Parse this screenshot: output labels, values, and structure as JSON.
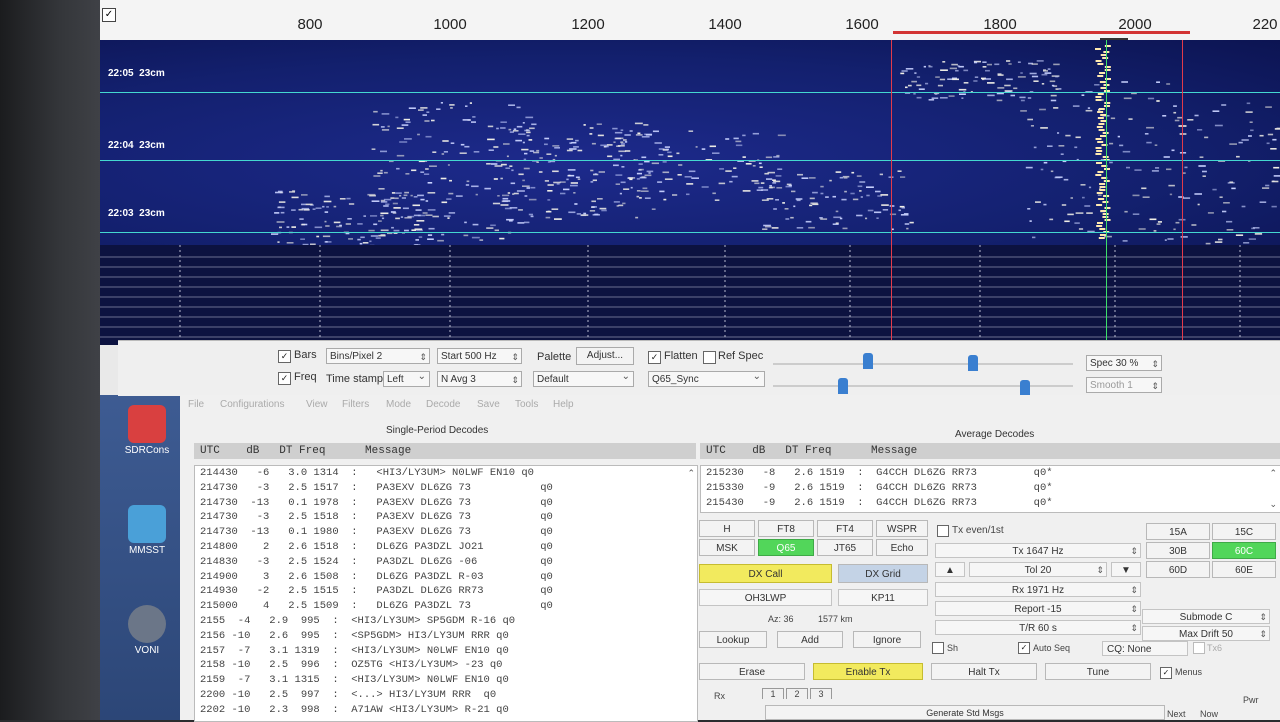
{
  "waterfall": {
    "freq_labels": [
      "800",
      "1000",
      "1200",
      "1400",
      "1600",
      "1800",
      "2000",
      "220"
    ],
    "time_labels": [
      {
        "time": "22:05",
        "band": "23cm"
      },
      {
        "time": "22:04",
        "band": "23cm"
      },
      {
        "time": "22:03",
        "band": "23cm"
      }
    ],
    "colors": {
      "rx_marker": "#d23434",
      "tx_marker": "#3dde6a",
      "trace": "#44d8d0"
    }
  },
  "controls": {
    "bars_label": "Bars",
    "freq_label": "Freq",
    "bins_per_pixel": "Bins/Pixel  2",
    "start": "Start 500 Hz",
    "time_stamp_label": "Time stamp",
    "time_stamp_value": "Left",
    "n_avg": "N Avg  3",
    "palette_label": "Palette",
    "adjust_label": "Adjust...",
    "palette_value": "Default",
    "flatten_label": "Flatten",
    "ref_spec_label": "Ref Spec",
    "mode_value": "Q65_Sync",
    "spec": "Spec  30 %",
    "smooth": "Smooth  1"
  },
  "main": {
    "menu": [
      "File",
      "Configurations",
      "View",
      "Filters",
      "Mode",
      "Decode",
      "Save",
      "Tools",
      "Help"
    ],
    "single_title": "Single-Period Decodes",
    "average_title": "Average Decodes",
    "header": "UTC    dB   DT Freq      Message",
    "single_decodes": [
      "214430   -6   3.0 1314  :   <HI3/LY3UM> N0LWF EN10 q0",
      "214730   -3   2.5 1517  :   PA3EXV DL6ZG 73           q0",
      "214730  -13   0.1 1978  :   PA3EXV DL6ZG 73           q0",
      "214730   -3   2.5 1518  :   PA3EXV DL6ZG 73           q0",
      "214730  -13   0.1 1980  :   PA3EXV DL6ZG 73           q0",
      "214800    2   2.6 1518  :   DL6ZG PA3DZL JO21         q0",
      "214830   -3   2.5 1524  :   PA3DZL DL6ZG -06          q0",
      "214900    3   2.6 1508  :   DL6ZG PA3DZL R-03         q0",
      "214930   -2   2.5 1515  :   PA3DZL DL6ZG RR73         q0",
      "215000    4   2.5 1509  :   DL6ZG PA3DZL 73           q0",
      "2155  -4   2.9  995  :  <HI3/LY3UM> SP5GDM R-16 q0",
      "2156 -10   2.6  995  :  <SP5GDM> HI3/LY3UM RRR q0",
      "2157  -7   3.1 1319  :  <HI3/LY3UM> N0LWF EN10 q0",
      "2158 -10   2.5  996  :  OZ5TG <HI3/LY3UM> -23 q0",
      "2159  -7   3.1 1315  :  <HI3/LY3UM> N0LWF EN10 q0",
      "2200 -10   2.5  997  :  <...> HI3/LY3UM RRR  q0",
      "2202 -10   2.3  998  :  A71AW <HI3/LY3UM> R-21 q0"
    ],
    "average_decodes": [
      "215230   -8   2.6 1519  :  G4CCH DL6ZG RR73         q0*",
      "215330   -9   2.6 1519  :  G4CCH DL6ZG RR73         q0*",
      "215430   -9   2.6 1519  :  G4CCH DL6ZG RR73         q0*"
    ],
    "mode_buttons": [
      "H",
      "FT8",
      "FT4",
      "WSPR",
      "MSK",
      "Q65",
      "JT65",
      "Echo"
    ],
    "dx_call_label": "DX Call",
    "dx_grid_label": "DX Grid",
    "dx_call_value": "OH3LWP",
    "dx_grid_value": "KP11",
    "az": "Az: 36",
    "distance": "1577 km",
    "lookup_label": "Lookup",
    "add_label": "Add",
    "ignore_label": "Ignore",
    "erase_label": "Erase",
    "enable_tx_label": "Enable Tx",
    "halt_tx_label": "Halt Tx",
    "tune_label": "Tune",
    "menus_label": "Menus",
    "rx_label": "Rx",
    "tabs": [
      "1",
      "2",
      "3"
    ],
    "generate_label": "Generate Std Msgs",
    "next_label": "Next",
    "now_label": "Now",
    "pwr_label": "Pwr",
    "tx_even_label": "Tx even/1st",
    "tx_freq": "Tx  1647 Hz",
    "tol": "Tol  20",
    "rx_freq": "Rx  1971 Hz",
    "report": "Report -15",
    "tr": "T/R  60 s",
    "sh_label": "Sh",
    "auto_seq_label": "Auto Seq",
    "cq_value": "CQ: None",
    "tx6_label": "Tx6",
    "submode": "Submode C",
    "max_drift": "Max Drift  50",
    "submode_buttons": [
      "15A",
      "15C",
      "30B",
      "60C",
      "60D",
      "60E"
    ]
  },
  "desktop": {
    "icons": [
      "SDRCons",
      "MMSST",
      "VONI"
    ]
  }
}
